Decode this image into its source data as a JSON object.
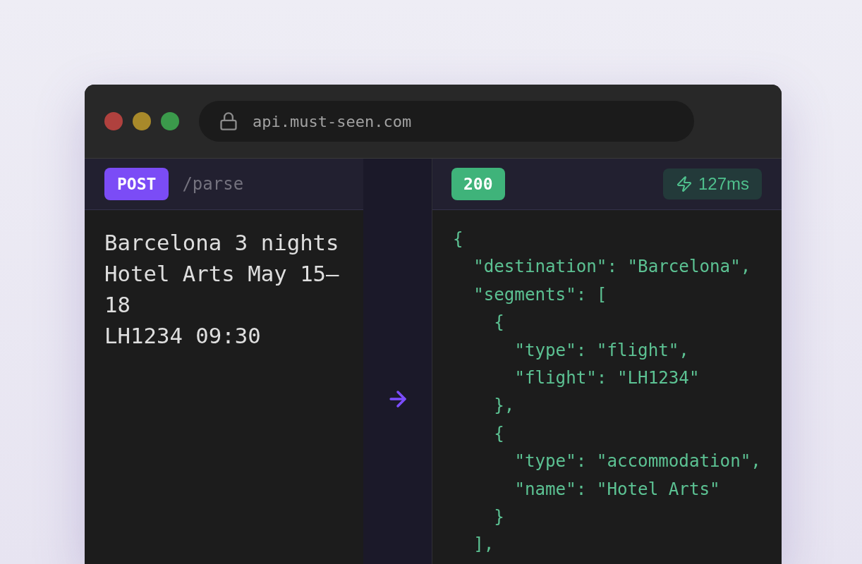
{
  "browser": {
    "url": "api.must-seen.com"
  },
  "request": {
    "method": "POST",
    "path": "/parse",
    "body_lines": [
      "Barcelona 3 nights",
      "Hotel Arts May 15–18",
      "LH1234 09:30"
    ]
  },
  "response": {
    "status": "200",
    "latency": "127ms",
    "body_lines": [
      "{",
      "  \"destination\": \"Barcelona\",",
      "  \"segments\": [",
      "    {",
      "      \"type\": \"flight\",",
      "      \"flight\": \"LH1234\"",
      "    },",
      "    {",
      "      \"type\": \"accommodation\",",
      "      \"name\": \"Hotel Arts\"",
      "    }",
      "  ],"
    ]
  }
}
